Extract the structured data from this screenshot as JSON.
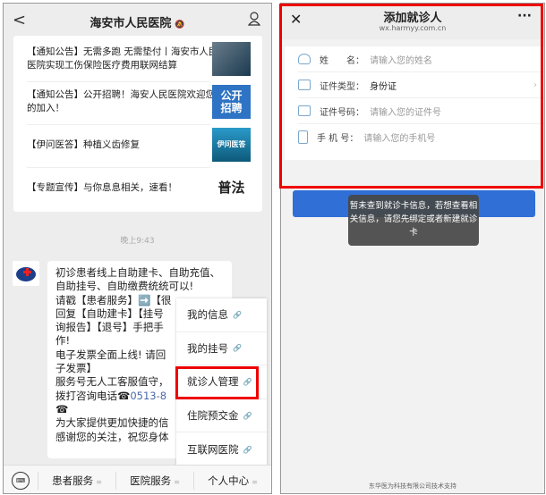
{
  "left": {
    "header": {
      "back": "<",
      "title": "海安市人民医院",
      "mute": "🔕"
    },
    "articles": [
      {
        "text": "【通知公告】无需多跑 无需垫付丨海安市人民医院实现工伤保险医疗费用联网结算",
        "thumb": ""
      },
      {
        "text": "【通知公告】公开招聘！海安人民医院欢迎您的加入！",
        "thumb": "公开\n招聘"
      },
      {
        "text": "【伊问医答】种植义齿修复",
        "thumb": "伊问医答"
      },
      {
        "text": "【专题宣传】与你息息相关，速看！",
        "thumb": "普法"
      }
    ],
    "time": "晚上9:43",
    "message": {
      "text": "初诊患者线上自助建卡、自助充值、自助挂号、自助缴费统统可以!\n请戳【患者服务】➡️【很\n回复【自助建卡】【挂号\n询报告】【退号】手把手\n作!\n电子发票全面上线! 请回\n子发票】\n服务号无人工客服值守，\n拨打咨询电话☎",
      "phone": "0513-8",
      "rest": "\n☎\n为大家提供更加快捷的信\n感谢您的关注，祝您身体"
    },
    "menu": [
      {
        "label": "我的信息"
      },
      {
        "label": "我的挂号"
      },
      {
        "label": "就诊人管理"
      },
      {
        "label": "住院预交金"
      },
      {
        "label": "互联网医院"
      }
    ],
    "bottom": [
      {
        "label": "患者服务"
      },
      {
        "label": "医院服务"
      },
      {
        "label": "个人中心"
      }
    ]
  },
  "right": {
    "header": {
      "close": "✕",
      "title": "添加就诊人",
      "url": "wx.harmyy.com.cn",
      "more": "···"
    },
    "form": [
      {
        "label": "姓　　名",
        "placeholder": "请输入您的姓名"
      },
      {
        "label": "证件类型",
        "value": "身份证"
      },
      {
        "label": "证件号码",
        "placeholder": "请输入您的证件号"
      },
      {
        "label": "手 机 号",
        "placeholder": "请输入您的手机号"
      }
    ],
    "toast": "暂未查到就诊卡信息，若想查看相关信息，请您先绑定或者新建就诊卡",
    "footer": "东华医为科技有限公司技术支持"
  },
  "colors": {
    "accent": "#2f6fd6",
    "highlight": "#e00000"
  }
}
